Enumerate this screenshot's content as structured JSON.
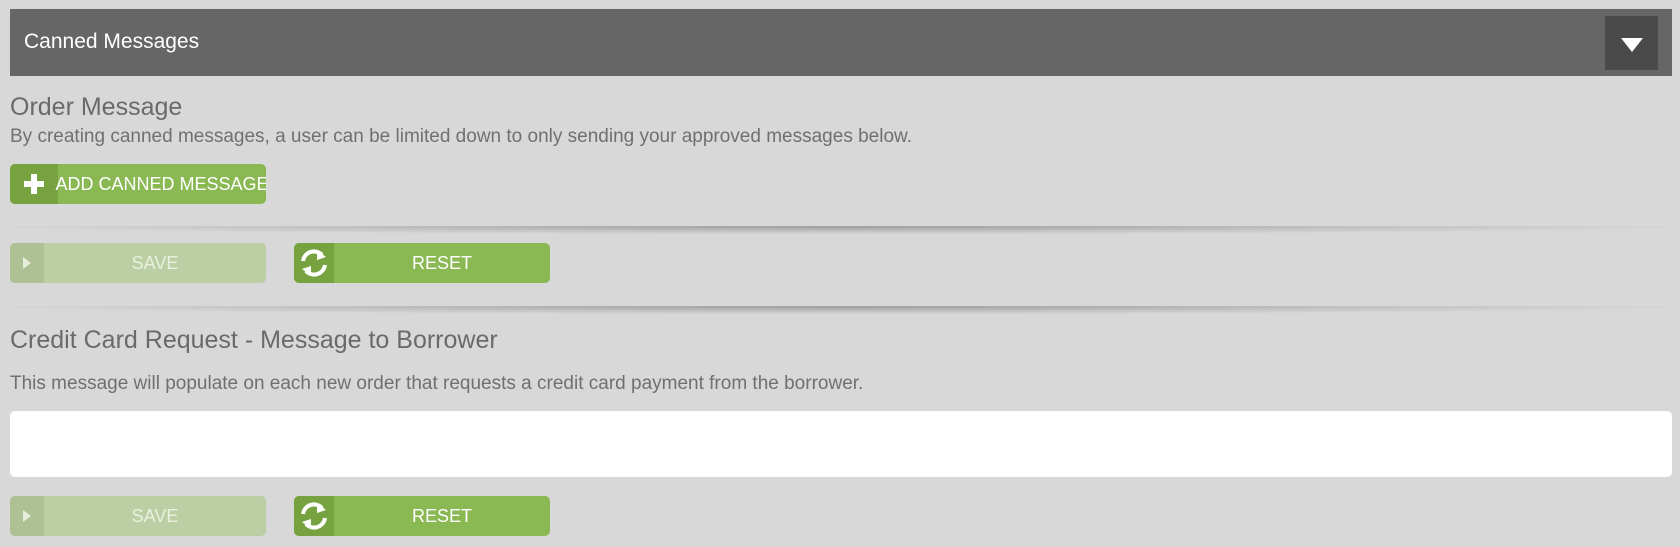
{
  "panel": {
    "title": "Canned Messages",
    "collapse_icon": "triangle-down-icon"
  },
  "order_message": {
    "title": "Order Message",
    "description": "By creating canned messages, a user can be limited down to only sending your approved messages below.",
    "add_button_label": "ADD CANNED MESSAGE",
    "save_label": "SAVE",
    "save_disabled": true,
    "reset_label": "RESET"
  },
  "credit_card_request": {
    "title": "Credit Card Request - Message to Borrower",
    "description": "This message will populate on each new order that requests a credit card payment from the borrower.",
    "message_value": "",
    "save_label": "SAVE",
    "save_disabled": true,
    "reset_label": "RESET"
  },
  "colors": {
    "header_bg": "#666666",
    "page_bg": "#d8d8d8",
    "accent_green": "#8ab853",
    "accent_green_dark": "#76a33f",
    "disabled_green": "#bccfa4"
  }
}
